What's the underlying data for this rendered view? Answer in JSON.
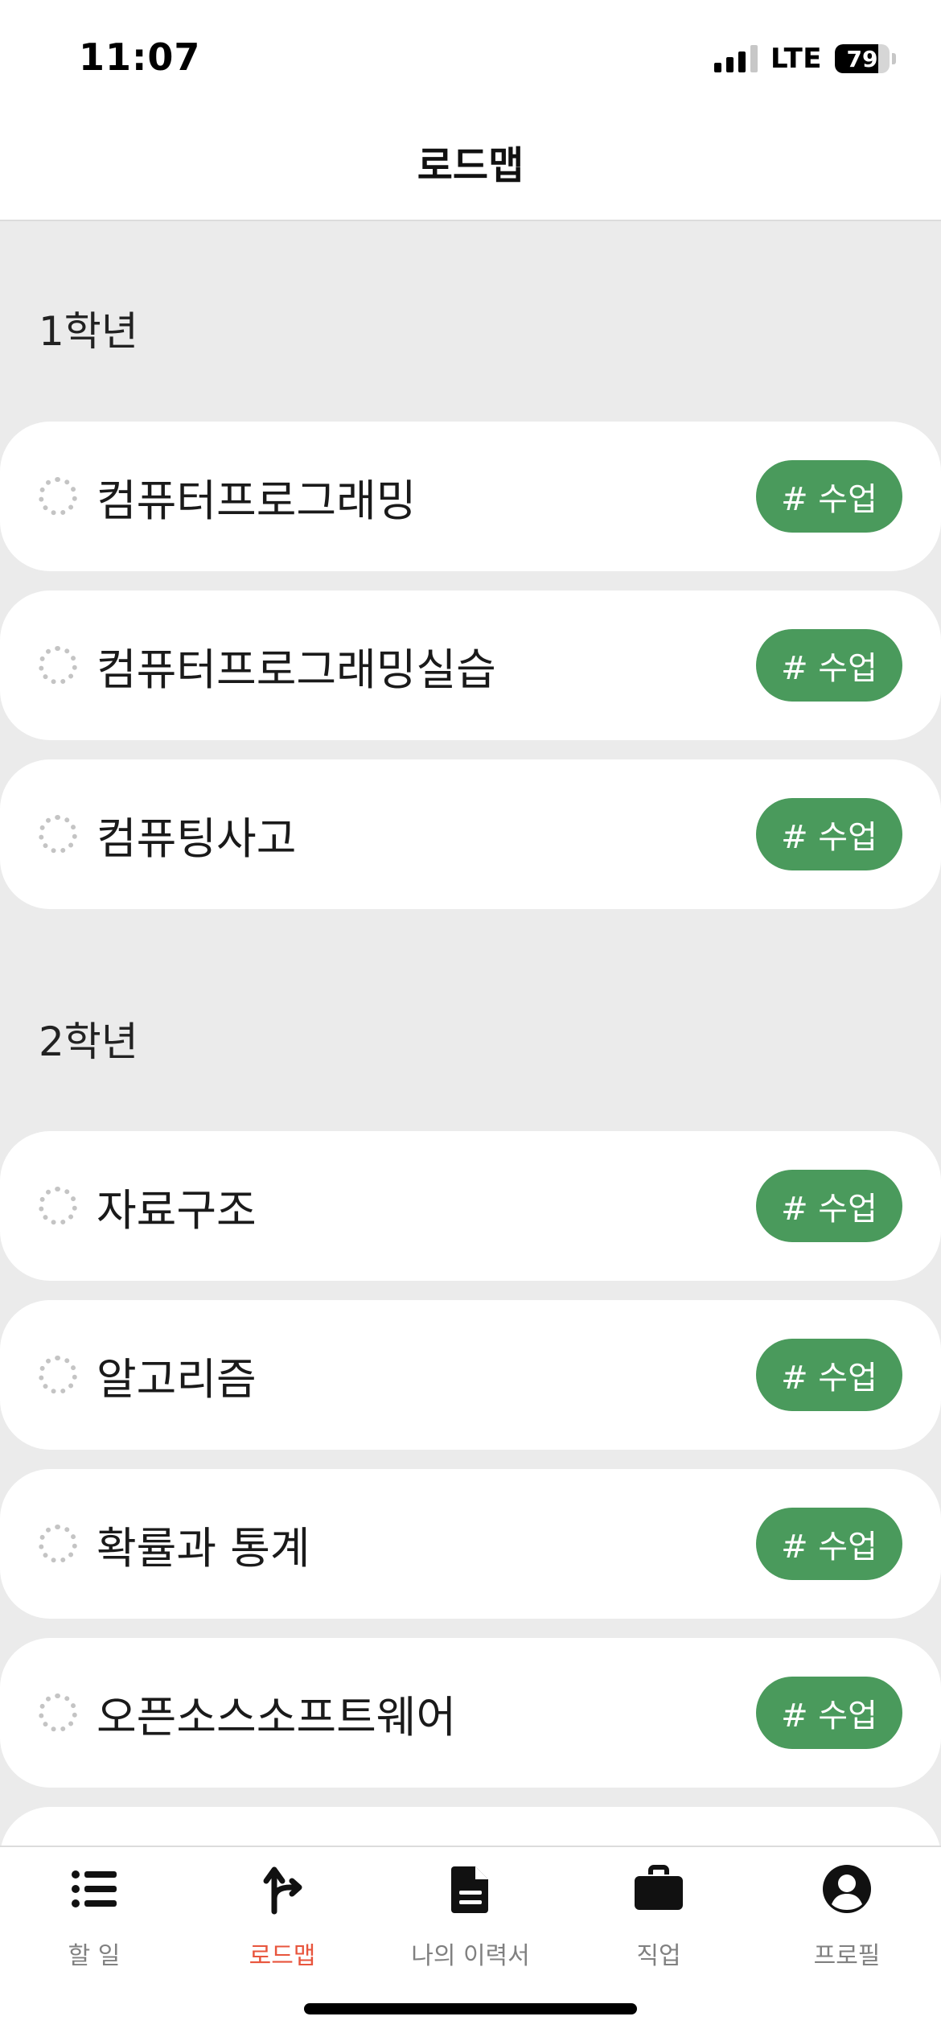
{
  "status_bar": {
    "time": "11:07",
    "network": "LTE",
    "battery_percent": "79",
    "battery_level": 0.79,
    "signal_bars_active": 3,
    "signal_bars_total": 4
  },
  "header": {
    "title": "로드맵"
  },
  "sections": [
    {
      "title": "1학년",
      "items": [
        {
          "label": "컴퓨터프로그래밍",
          "tag": "# 수업"
        },
        {
          "label": "컴퓨터프로그래밍실습",
          "tag": "# 수업"
        },
        {
          "label": "컴퓨팅사고",
          "tag": "# 수업"
        }
      ]
    },
    {
      "title": "2학년",
      "items": [
        {
          "label": "자료구조",
          "tag": "# 수업"
        },
        {
          "label": "알고리즘",
          "tag": "# 수업"
        },
        {
          "label": "확률과 통계",
          "tag": "# 수업"
        },
        {
          "label": "오픈소스소프트웨어",
          "tag": "# 수업"
        }
      ]
    }
  ],
  "tab_bar": {
    "tabs": [
      {
        "label": "할 일",
        "icon": "list-icon",
        "active": false
      },
      {
        "label": "로드맵",
        "icon": "route-icon",
        "active": true
      },
      {
        "label": "나의 이력서",
        "icon": "document-icon",
        "active": false
      },
      {
        "label": "직업",
        "icon": "briefcase-icon",
        "active": false
      },
      {
        "label": "프로필",
        "icon": "user-circle-icon",
        "active": false
      }
    ]
  },
  "colors": {
    "tag_green": "#4a9a5c",
    "active_tab": "#e8553d",
    "inactive_tab": "#808080",
    "background": "#ebebeb"
  }
}
